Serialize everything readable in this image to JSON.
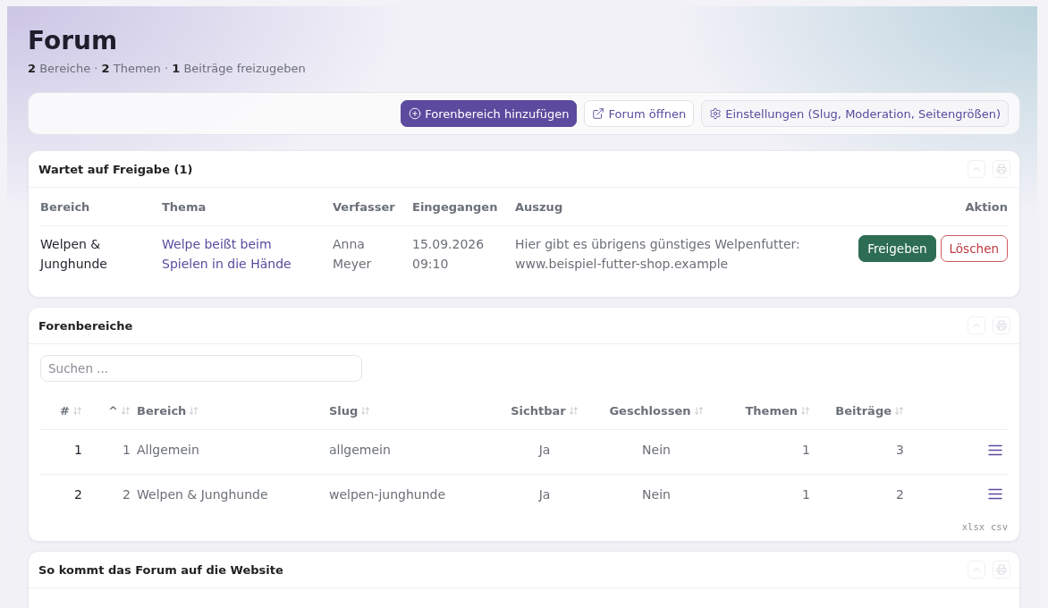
{
  "header": {
    "title": "Forum",
    "summary": "**2** Bereiche · **2** Themen · **1** Beiträge freizugeben"
  },
  "toolbar": {
    "buttons": [
      {
        "kind": "add",
        "label": "Forenbereich hinzufügen"
      },
      {
        "kind": "external",
        "label": "Forum öffnen"
      },
      {
        "kind": "settings",
        "label": "Einstellungen (Slug, Moderation, Seitengrößen)"
      }
    ]
  },
  "pending_panel": {
    "title": "Wartet auf Freigabe (1)",
    "columns": [
      "Bereich",
      "Thema",
      "Verfasser",
      "Eingegangen",
      "Auszug",
      "Aktion"
    ],
    "rows": [
      {
        "section": "Welpen & Junghunde",
        "topic": "Welpe beißt beim Spielen in die Hände",
        "author": "Anna Meyer",
        "received": "15.09.2026 09:10",
        "excerpt": "Hier gibt es übrigens günstiges Welpenfutter: www.beispiel-futter-shop.example",
        "actions": [
          {
            "kind": "approve",
            "label": "Freigeben"
          },
          {
            "kind": "delete",
            "label": "Löschen"
          }
        ]
      }
    ]
  },
  "sections_panel": {
    "title": "Forenbereiche",
    "search": {
      "placeholder": "Suchen ..."
    },
    "columns": [
      {
        "label": "#",
        "sortable": true
      },
      {
        "label": "^",
        "sortable": true
      },
      {
        "label": "Bereich",
        "sortable": true
      },
      {
        "label": "Slug",
        "sortable": true
      },
      {
        "label": "Sichtbar",
        "sortable": true
      },
      {
        "label": "Geschlossen",
        "sortable": true
      },
      {
        "label": "Themen",
        "sortable": true
      },
      {
        "label": "Beiträge",
        "sortable": true
      }
    ],
    "rows": [
      {
        "cells": [
          "1",
          "1",
          "Allgemein",
          "allgemein",
          "Ja",
          "Nein",
          "1",
          "3"
        ]
      },
      {
        "cells": [
          "2",
          "2",
          "Welpen & Junghunde",
          "welpen-junghunde",
          "Ja",
          "Nein",
          "1",
          "2"
        ]
      }
    ],
    "exports": [
      "xlsx",
      "csv"
    ]
  },
  "embed_panel": {
    "title": "So kommt das Forum auf die Website"
  }
}
